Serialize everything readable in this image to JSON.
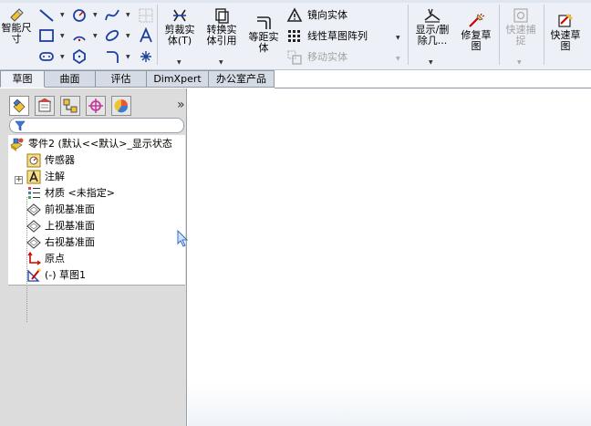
{
  "ribbon": {
    "smart_dimension": {
      "label": "智能尺寸",
      "icon": "smart-dimension-icon"
    },
    "sketch_tools": [
      {
        "icon": "line-icon"
      },
      {
        "icon": "circle-icon"
      },
      {
        "icon": "spline-icon"
      },
      {
        "icon": "grid-icon"
      },
      {
        "icon": "rectangle-icon"
      },
      {
        "icon": "arc-icon"
      },
      {
        "icon": "ellipse-icon"
      },
      {
        "icon": "text-icon"
      },
      {
        "icon": "slot-icon"
      },
      {
        "icon": "polygon-icon"
      },
      {
        "icon": "fillet-icon"
      },
      {
        "icon": "point-icon"
      }
    ],
    "trim_entities": {
      "label_line1": "剪裁实",
      "label_line2": "体(T)",
      "icon": "trim-icon"
    },
    "convert_entities": {
      "label_line1": "转换实",
      "label_line2": "体引用",
      "icon": "convert-icon"
    },
    "offset_entities": {
      "label_line1": "等距实",
      "label_line2": "体",
      "icon": "offset-icon"
    },
    "mirror_entities": {
      "label": "镜向实体",
      "icon": "mirror-icon"
    },
    "linear_pattern": {
      "label": "线性草图阵列",
      "icon": "linear-pattern-icon"
    },
    "move_entities": {
      "label": "移动实体",
      "icon": "move-icon",
      "enabled": false
    },
    "display_delete": {
      "label_line1": "显示/删",
      "label_line2": "除几...",
      "icon": "display-delete-relations-icon"
    },
    "repair_sketch": {
      "label_line1": "修复草",
      "label_line2": "图",
      "icon": "repair-sketch-icon"
    },
    "quick_snaps": {
      "label_line1": "快速捕",
      "label_line2": "捉",
      "icon": "quick-snaps-icon",
      "enabled": false
    },
    "rapid_sketch": {
      "label_line1": "快速草",
      "label_line2": "图",
      "icon": "rapid-sketch-icon"
    }
  },
  "tabs": [
    {
      "label": "草图",
      "active": true
    },
    {
      "label": "曲面",
      "active": false
    },
    {
      "label": "评估",
      "active": false
    },
    {
      "label": "DimXpert",
      "active": false
    },
    {
      "label": "办公室产品",
      "active": false
    }
  ],
  "panel": {
    "tabs": [
      {
        "icon": "feature-manager-icon"
      },
      {
        "icon": "property-manager-icon"
      },
      {
        "icon": "configuration-manager-icon"
      },
      {
        "icon": "dimxpert-manager-icon"
      },
      {
        "icon": "display-manager-icon"
      }
    ],
    "expand_glyph": "»",
    "filter_icon": "filter-icon"
  },
  "tree": {
    "root": {
      "label": "零件2  (默认<<默认>_显示状态",
      "icon": "part-icon"
    },
    "items": [
      {
        "label": "传感器",
        "icon": "sensor-icon"
      },
      {
        "label": "注解",
        "icon": "annotations-icon",
        "expandable": true
      },
      {
        "label": "材质 <未指定>",
        "icon": "material-icon"
      },
      {
        "label": "前视基准面",
        "icon": "plane-icon"
      },
      {
        "label": "上视基准面",
        "icon": "plane-icon"
      },
      {
        "label": "右视基准面",
        "icon": "plane-icon"
      },
      {
        "label": "原点",
        "icon": "origin-icon"
      },
      {
        "label": "(-) 草图1",
        "icon": "sketch-icon"
      }
    ]
  },
  "colors": {
    "ribbon_bg": "#edf1f7",
    "tab_bg": "#d5dbe4",
    "pane_bg": "#dcdcdc",
    "graphics_bg": "#ffffff",
    "disabled_text": "#a3a3a3"
  }
}
